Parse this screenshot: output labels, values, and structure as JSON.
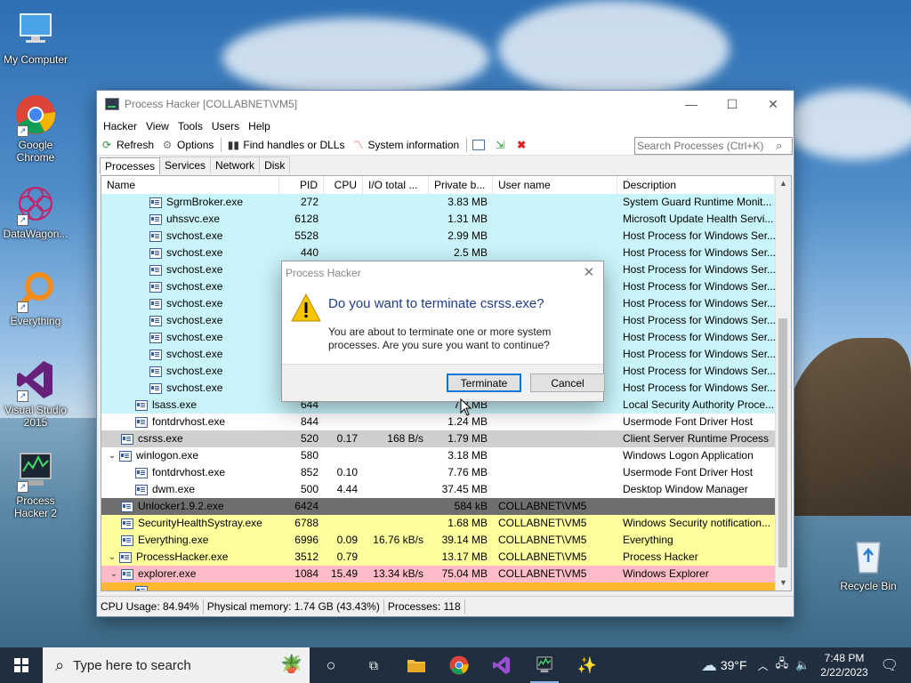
{
  "desktop": {
    "icons": [
      {
        "label": "My Computer",
        "icon": "computer-icon"
      },
      {
        "label": "Google Chrome",
        "icon": "chrome-icon"
      },
      {
        "label": "DataWagon...",
        "icon": "datawagon-icon"
      },
      {
        "label": "Everything",
        "icon": "everything-icon"
      },
      {
        "label": "Visual Studio 2015",
        "icon": "visual-studio-icon"
      },
      {
        "label": "Process Hacker 2",
        "icon": "process-hacker-icon"
      },
      {
        "label": "Recycle Bin",
        "icon": "recycle-bin-icon"
      }
    ]
  },
  "window": {
    "title": "Process Hacker [COLLABNET\\VM5]",
    "menu": [
      "Hacker",
      "View",
      "Tools",
      "Users",
      "Help"
    ],
    "toolbar": {
      "refresh": "Refresh",
      "options": "Options",
      "find_handles": "Find handles or DLLs",
      "system_info": "System information"
    },
    "search_placeholder": "Search Processes (Ctrl+K)",
    "tabs": [
      "Processes",
      "Services",
      "Network",
      "Disk"
    ],
    "columns": [
      "Name",
      "PID",
      "CPU",
      "I/O total ...",
      "Private b...",
      "User name",
      "Description"
    ],
    "rows": [
      {
        "name": "SgrmBroker.exe",
        "pid": "272",
        "cpu": "",
        "io": "",
        "priv": "3.83 MB",
        "user": "",
        "desc": "System Guard Runtime Monit...",
        "color": "cyan",
        "indent": 3
      },
      {
        "name": "uhssvc.exe",
        "pid": "6128",
        "cpu": "",
        "io": "",
        "priv": "1.31 MB",
        "user": "",
        "desc": "Microsoft Update Health Servi...",
        "color": "cyan",
        "indent": 3
      },
      {
        "name": "svchost.exe",
        "pid": "5528",
        "cpu": "",
        "io": "",
        "priv": "2.99 MB",
        "user": "",
        "desc": "Host Process for Windows Ser...",
        "color": "cyan",
        "indent": 3
      },
      {
        "name": "svchost.exe",
        "pid": "440",
        "cpu": "",
        "io": "",
        "priv": "2.5 MB",
        "user": "",
        "desc": "Host Process for Windows Ser...",
        "color": "cyan",
        "indent": 3
      },
      {
        "name": "svchost.exe",
        "pid": "",
        "cpu": "",
        "io": "",
        "priv": "",
        "user": "",
        "desc": "Host Process for Windows Ser...",
        "color": "cyan",
        "indent": 3
      },
      {
        "name": "svchost.exe",
        "pid": "",
        "cpu": "",
        "io": "",
        "priv": "",
        "user": "",
        "desc": "Host Process for Windows Ser...",
        "color": "cyan",
        "indent": 3
      },
      {
        "name": "svchost.exe",
        "pid": "",
        "cpu": "",
        "io": "",
        "priv": "",
        "user": "",
        "desc": "Host Process for Windows Ser...",
        "color": "cyan",
        "indent": 3
      },
      {
        "name": "svchost.exe",
        "pid": "",
        "cpu": "",
        "io": "",
        "priv": "",
        "user": "",
        "desc": "Host Process for Windows Ser...",
        "color": "cyan",
        "indent": 3
      },
      {
        "name": "svchost.exe",
        "pid": "",
        "cpu": "",
        "io": "",
        "priv": "",
        "user": "",
        "desc": "Host Process for Windows Ser...",
        "color": "cyan",
        "indent": 3
      },
      {
        "name": "svchost.exe",
        "pid": "",
        "cpu": "",
        "io": "",
        "priv": "",
        "user": "",
        "desc": "Host Process for Windows Ser...",
        "color": "cyan",
        "indent": 3
      },
      {
        "name": "svchost.exe",
        "pid": "",
        "cpu": "",
        "io": "",
        "priv": "",
        "user": "",
        "desc": "Host Process for Windows Ser...",
        "color": "cyan",
        "indent": 3
      },
      {
        "name": "svchost.exe",
        "pid": "",
        "cpu": "",
        "io": "",
        "priv": "",
        "user": "",
        "desc": "Host Process for Windows Ser...",
        "color": "cyan",
        "indent": 3
      },
      {
        "name": "lsass.exe",
        "pid": "644",
        "cpu": "",
        "io": "",
        "priv": "7.2 MB",
        "user": "",
        "desc": "Local Security Authority Proce...",
        "color": "cyan",
        "indent": 2
      },
      {
        "name": "fontdrvhost.exe",
        "pid": "844",
        "cpu": "",
        "io": "",
        "priv": "1.24 MB",
        "user": "",
        "desc": "Usermode Font Driver Host",
        "color": "white",
        "indent": 2
      },
      {
        "name": "csrss.exe",
        "pid": "520",
        "cpu": "0.17",
        "io": "168 B/s",
        "priv": "1.79 MB",
        "user": "",
        "desc": "Client Server Runtime Process",
        "color": "gray",
        "indent": 1
      },
      {
        "name": "winlogon.exe",
        "pid": "580",
        "cpu": "",
        "io": "",
        "priv": "3.18 MB",
        "user": "",
        "desc": "Windows Logon Application",
        "color": "white",
        "indent": 0,
        "expand": "v"
      },
      {
        "name": "fontdrvhost.exe",
        "pid": "852",
        "cpu": "0.10",
        "io": "",
        "priv": "7.76 MB",
        "user": "",
        "desc": "Usermode Font Driver Host",
        "color": "white",
        "indent": 2
      },
      {
        "name": "dwm.exe",
        "pid": "500",
        "cpu": "4.44",
        "io": "",
        "priv": "37.45 MB",
        "user": "",
        "desc": "Desktop Window Manager",
        "color": "white",
        "indent": 2
      },
      {
        "name": "Unlocker1.9.2.exe",
        "pid": "6424",
        "cpu": "",
        "io": "",
        "priv": "584 kB",
        "user": "COLLABNET\\VM5",
        "desc": "",
        "color": "dark",
        "indent": 1
      },
      {
        "name": "SecurityHealthSystray.exe",
        "pid": "6788",
        "cpu": "",
        "io": "",
        "priv": "1.68 MB",
        "user": "COLLABNET\\VM5",
        "desc": "Windows Security notification...",
        "color": "yellow",
        "indent": 1
      },
      {
        "name": "Everything.exe",
        "pid": "6996",
        "cpu": "0.09",
        "io": "16.76 kB/s",
        "priv": "39.14 MB",
        "user": "COLLABNET\\VM5",
        "desc": "Everything",
        "color": "yellow",
        "indent": 1
      },
      {
        "name": "ProcessHacker.exe",
        "pid": "3512",
        "cpu": "0.79",
        "io": "",
        "priv": "13.17 MB",
        "user": "COLLABNET\\VM5",
        "desc": "Process Hacker",
        "color": "yellow",
        "indent": 0,
        "expand": "v"
      },
      {
        "name": "explorer.exe",
        "pid": "1084",
        "cpu": "15.49",
        "io": "13.34 kB/s",
        "priv": "75.04 MB",
        "user": "COLLABNET\\VM5",
        "desc": "Windows Explorer",
        "color": "pink",
        "indent": 1,
        "expand": "v"
      },
      {
        "name": "",
        "pid": "",
        "cpu": "",
        "io": "",
        "priv": "",
        "user": "",
        "desc": "",
        "color": "orange",
        "indent": 2
      }
    ],
    "status": {
      "cpu": "CPU Usage: 84.94%",
      "memory": "Physical memory: 1.74 GB (43.43%)",
      "processes": "Processes: 118"
    }
  },
  "dialog": {
    "title": "Process Hacker",
    "question": "Do you want to terminate csrss.exe?",
    "message": "You are about to terminate one or more system processes. Are you sure you want to continue?",
    "terminate": "Terminate",
    "cancel": "Cancel"
  },
  "taskbar": {
    "search_placeholder": "Type here to search",
    "weather": "39°F",
    "time": "7:48 PM",
    "date": "2/22/2023"
  }
}
